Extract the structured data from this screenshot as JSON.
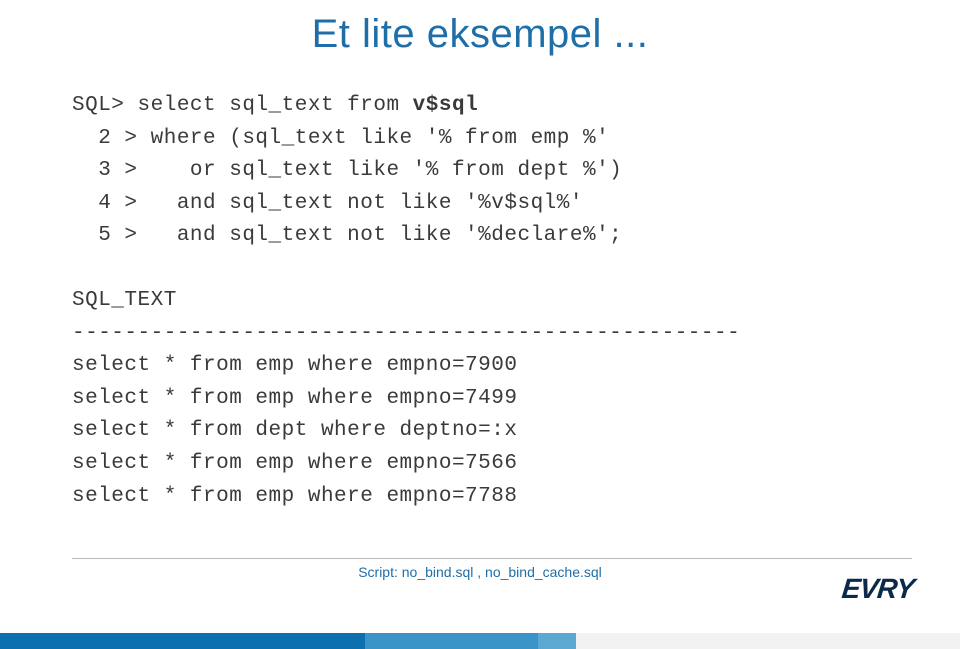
{
  "title": "Et lite eksempel ...",
  "code": {
    "line1_a": "SQL> select sql_text from ",
    "line1_b": "v$sql",
    "line2": "  2 > where (sql_text like '% from emp %'",
    "line3": "  3 >    or sql_text like '% from dept %')",
    "line4": "  4 >   and sql_text not like '%v$sql%'",
    "line5": "  5 >   and sql_text not like '%declare%';",
    "blank": " ",
    "hdr": "SQL_TEXT",
    "dashes": "---------------------------------------------------",
    "r1": "select * from emp where empno=7900",
    "r2": "select * from emp where empno=7499",
    "r3": "select * from dept where deptno=:x",
    "r4": "select * from emp where empno=7566",
    "r5": "select * from emp where empno=7788"
  },
  "script_note": "Script: no_bind.sql , no_bind_cache.sql",
  "logo_text": "EVRY"
}
